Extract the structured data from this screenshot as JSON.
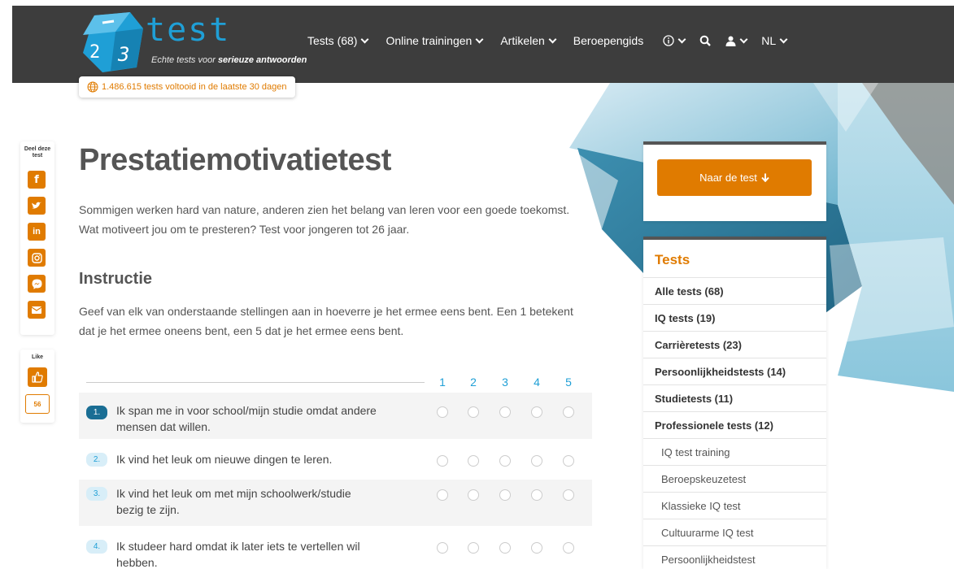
{
  "header": {
    "logo_text": "test",
    "logo_digits": [
      "2",
      "3"
    ],
    "tagline_prefix": "Echte tests voor ",
    "tagline_bold": "serieuze antwoorden",
    "nav": [
      {
        "label": "Tests (68)"
      },
      {
        "label": "Online trainingen"
      },
      {
        "label": "Artikelen"
      },
      {
        "label": "Beroepengids"
      }
    ],
    "language": "NL",
    "counter_text": "1.486.615 tests voltooid in de laatste 30 dagen"
  },
  "share": {
    "label_line1": "Deel deze",
    "label_line2": "test",
    "buttons": [
      "facebook-icon",
      "twitter-icon",
      "linkedin-icon",
      "instagram-icon",
      "messenger-icon",
      "mail-icon"
    ],
    "like_label": "Like",
    "like_count": "56"
  },
  "main": {
    "title": "Prestatiemotivatietest",
    "intro_line1": "Sommigen werken hard van nature, anderen zien het belang van leren voor een goede toekomst.",
    "intro_line2": "Wat motiveert jou om te presteren? Test voor jongeren tot 26 jaar.",
    "instruction_heading": "Instructie",
    "instruction_line1": "Geef van elk van onderstaande stellingen aan in hoeverre je het ermee eens bent. Een 1 betekent",
    "instruction_line2": "dat je het ermee oneens bent, een 5 dat je het ermee eens bent.",
    "scale": [
      "1",
      "2",
      "3",
      "4",
      "5"
    ],
    "questions": [
      {
        "num": "1.",
        "line1": "Ik span me in voor school/mijn studie omdat andere",
        "line2": "mensen dat willen."
      },
      {
        "num": "2.",
        "line1": "Ik vind het leuk om nieuwe dingen te leren.",
        "line2": ""
      },
      {
        "num": "3.",
        "line1": "Ik vind het leuk om met mijn schoolwerk/studie",
        "line2": "bezig te zijn."
      },
      {
        "num": "4.",
        "line1": "Ik studeer hard omdat ik later iets te vertellen wil",
        "line2": "hebben."
      }
    ]
  },
  "sidebar": {
    "cta_label": "Naar de test",
    "tests_title": "Tests",
    "items": [
      "Alle tests (68)",
      "IQ tests (19)",
      "Carrièretests (23)",
      "Persoonlijkheidstests (14)",
      "Studietests (11)",
      "Professionele tests (12)",
      "IQ test training",
      "Beroepskeuzetest",
      "Klassieke IQ test",
      "Cultuurarme IQ test",
      "Persoonlijkheidstest"
    ]
  },
  "colors": {
    "accent": "#e07b00",
    "brand_blue": "#1f9fd6",
    "header_bg": "#3d3d3d"
  }
}
